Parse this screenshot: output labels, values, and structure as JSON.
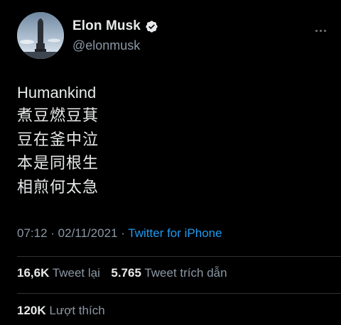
{
  "author": {
    "display_name": "Elon Musk",
    "handle": "@elonmusk",
    "avatar_icon": "starship-photo-avatar",
    "verified_icon": "verified-badge-icon"
  },
  "tweet": {
    "lines": [
      "Humankind",
      "煮豆燃豆萁",
      "豆在釜中泣",
      "本是同根生",
      "相煎何太急"
    ]
  },
  "meta": {
    "time": "07:12",
    "date": "02/11/2021",
    "separator": " · ",
    "source": "Twitter for iPhone"
  },
  "stats": {
    "retweets_count": "16,6K",
    "retweets_label": "Tweet lại",
    "quotes_count": "5.765",
    "quotes_label": "Tweet trích dẫn",
    "likes_count": "120K",
    "likes_label": "Lượt thích"
  },
  "colors": {
    "background": "#000000",
    "text": "#e7e9ea",
    "secondary": "#8b98a5",
    "link": "#1d9bf0",
    "divider": "#2f3336"
  }
}
